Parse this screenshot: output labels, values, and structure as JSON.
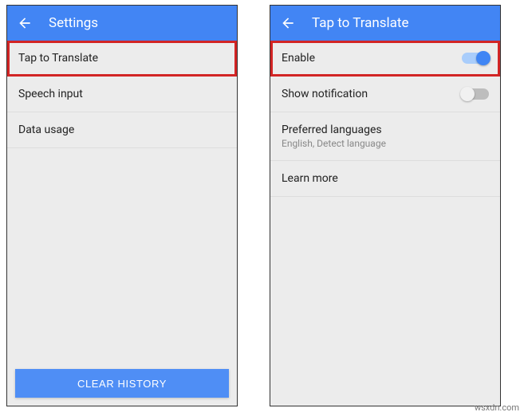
{
  "left": {
    "title": "Settings",
    "rows": {
      "tap_to_translate": "Tap to Translate",
      "speech_input": "Speech input",
      "data_usage": "Data usage"
    },
    "clear_history": "CLEAR HISTORY"
  },
  "right": {
    "title": "Tap to Translate",
    "rows": {
      "enable": "Enable",
      "show_notification": "Show notification",
      "preferred_languages": "Preferred languages",
      "preferred_languages_sub": "English, Detect language",
      "learn_more": "Learn more"
    }
  },
  "watermark": "wsxdn.com"
}
